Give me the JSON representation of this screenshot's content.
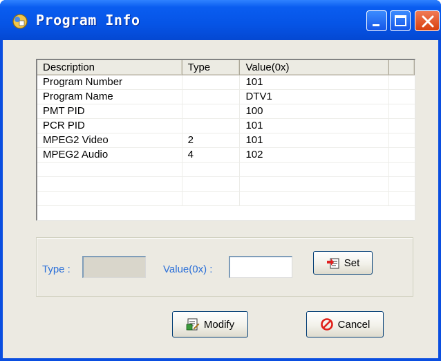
{
  "window": {
    "title": "Program Info"
  },
  "table": {
    "columns": [
      "Description",
      "Type",
      "Value(0x)",
      ""
    ],
    "rows": [
      [
        "Program Number",
        "",
        "101"
      ],
      [
        "Program Name",
        "",
        "DTV1"
      ],
      [
        "PMT PID",
        "",
        "100"
      ],
      [
        "PCR PID",
        "",
        "101"
      ],
      [
        "MPEG2 Video",
        "2",
        "101"
      ],
      [
        "MPEG2 Audio",
        "4",
        "102"
      ]
    ],
    "empty_rows": 3
  },
  "edit": {
    "type_label": "Type :",
    "type_value": "",
    "value_label": "Value(0x) :",
    "value_value": "",
    "set_label": "Set"
  },
  "buttons": {
    "modify": "Modify",
    "cancel": "Cancel"
  },
  "icons": {
    "title": "info-icon",
    "set": "set-icon",
    "modify": "modify-icon",
    "cancel": "cancel-icon",
    "minimize": "minimize-icon",
    "maximize": "maximize-icon",
    "close": "close-icon"
  },
  "colors": {
    "titlebar": "#0654e6",
    "client": "#eceae2",
    "label": "#2a6fd8",
    "cancel_icon": "#e0201a"
  }
}
